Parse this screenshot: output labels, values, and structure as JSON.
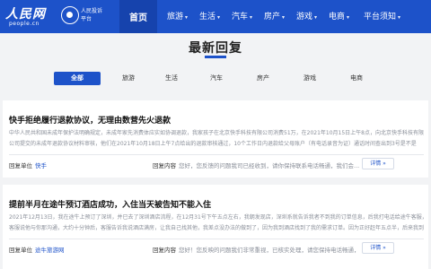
{
  "header": {
    "logo_text": "人民网",
    "logo_sub": "people.cn",
    "subbrand_line1": "人民投诉",
    "subbrand_line2": "平台"
  },
  "nav": {
    "items": [
      {
        "label": "首页",
        "active": true
      },
      {
        "label": "旅游",
        "dropdown": true
      },
      {
        "label": "生活",
        "dropdown": true
      },
      {
        "label": "汽车",
        "dropdown": true
      },
      {
        "label": "房产",
        "dropdown": true
      },
      {
        "label": "游戏",
        "dropdown": true
      },
      {
        "label": "电商",
        "dropdown": true
      },
      {
        "label": "平台须知",
        "dropdown": true
      }
    ]
  },
  "page": {
    "title": "最新回复"
  },
  "tabs": [
    {
      "label": "全部",
      "active": true
    },
    {
      "label": "旅游"
    },
    {
      "label": "生活"
    },
    {
      "label": "汽车"
    },
    {
      "label": "房产"
    },
    {
      "label": "游戏"
    },
    {
      "label": "电商"
    }
  ],
  "posts": [
    {
      "headline": "快手拒绝履行退款协议，无理由数营先火退款",
      "body_line1": "中华人民共和国未成年保护法明确规定，未成年家先消费体应实如协调退款，我家孩子在北京快手科技有限公司消费51万，在2021年10月15日上午8点，向北京快手科技有限",
      "body_line2": "公司提交的未成年退款协议材料审核，他们在2021年10月18日上午7点给出的退款审核通过，10个工作日内退款给父母账户（有电话录音为证）通话时间查出到3号是不是",
      "meta_label": "回复单位",
      "meta_value": "快手",
      "reply_label": "回复内容",
      "reply_value": "您好，您反馈的问题我司已经收到，请你保持联系电话畅通，我们会...",
      "detail_label": "详情 »"
    },
    {
      "headline": "提前半月在途牛预订酒店成功，入住当天被告知不能入住",
      "body_line1": "2021年12月13日，我在途牛上预订了深圳，并已去了深圳酒店流程，在12月31号下午五点左右，我朝发现店，深圳系就告诉我者不到我的订单信息，后我打电话给途牛客服，",
      "body_line2": "客服说他与你那沟通，大约十分钟后，客服告诉我说酒店满房，让我自己找其他，我差点没办法的做到了，因为我到酒店找到了我的需求订单。因为正好赶年五点半，后来我到了。我又要小",
      "meta_label": "回复单位",
      "meta_value": "途牛旅游网",
      "reply_label": "回复内容",
      "reply_value": "您好！您反映的问题我们非常重视，已核实处理，请您保持电话畅通，",
      "detail_label": "详情 »"
    }
  ],
  "colors": {
    "brand_blue": "#1d52c9",
    "page_bg": "#f2f3f5",
    "muted_text": "#8a8f99"
  }
}
